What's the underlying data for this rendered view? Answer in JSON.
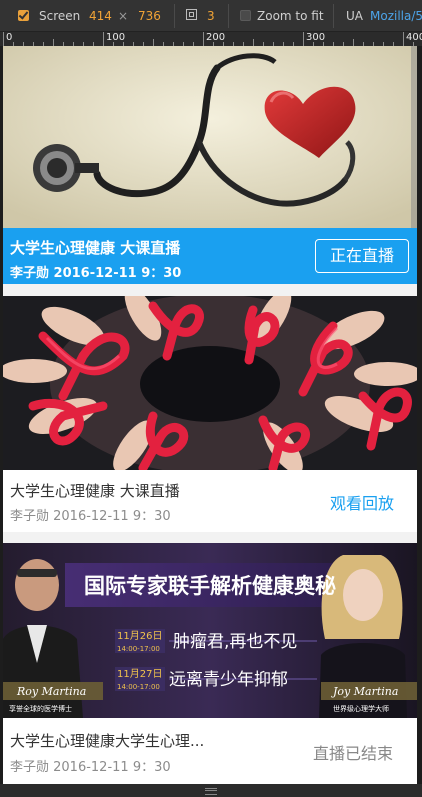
{
  "devtools": {
    "screen_label": "Screen",
    "width": "414",
    "times": "×",
    "height": "736",
    "dpr": "3",
    "zoom_label": "Zoom to fit",
    "ua_label": "UA",
    "ua_value": "Mozilla/5.",
    "ruler_labels": [
      "0",
      "100",
      "200",
      "300",
      "400"
    ]
  },
  "cards": [
    {
      "status": "live",
      "title": "大学生心理健康 大课直播",
      "meta": "李子勋 2016-12-11 9：30",
      "action": "正在直播"
    },
    {
      "status": "replay",
      "title": "大学生心理健康 大课直播",
      "meta": "李子勋 2016-12-11 9：30",
      "action": "观看回放"
    },
    {
      "status": "ended",
      "title": "大学生心理健康大学生心理...",
      "meta": "李子勋 2016-12-11 9：30",
      "action": "直播已结束",
      "poster": {
        "headline": "国际专家联手解析健康奥秘",
        "date1": "11月26日",
        "time1": "14:00-17:00",
        "topic1": "肿瘤君,再也不见",
        "date2": "11月27日",
        "time2": "14:00-17:00",
        "topic2": "远离青少年抑郁",
        "left_name": "Roy Martina",
        "left_caption": "享誉全球的医学博士",
        "right_name": "Joy Martina",
        "right_caption": "世界级心理学大师"
      }
    }
  ],
  "colors": {
    "accent": "#1aa0f0",
    "orange": "#f0a336"
  }
}
